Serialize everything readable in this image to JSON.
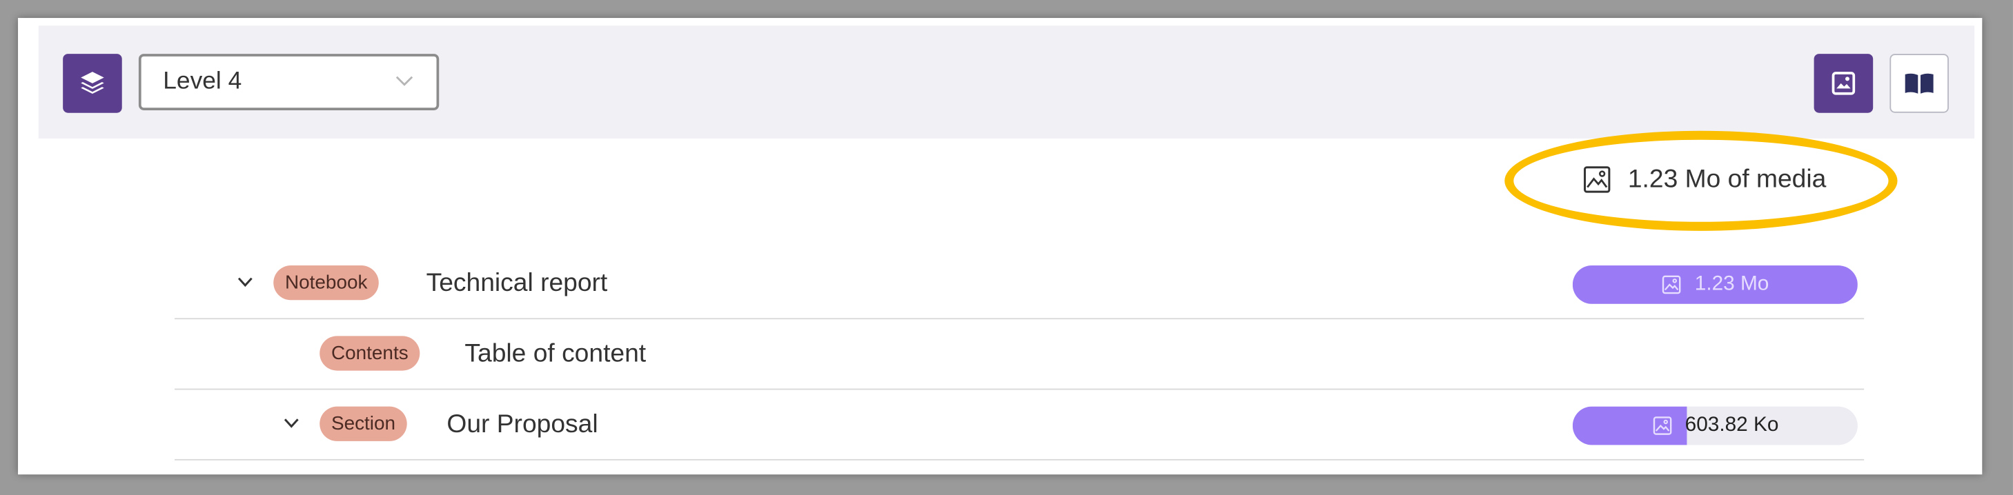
{
  "toolbar": {
    "level_select": {
      "selected": "Level 4"
    },
    "icons": {
      "layers": "layers-icon",
      "media": "image-icon",
      "book": "book-open-icon"
    }
  },
  "media_summary": {
    "label": "1.23 Mo of media",
    "icon": "image-icon",
    "highlight_color": "#fbbf00"
  },
  "tree": {
    "rows": [
      {
        "type_badge": "Notebook",
        "title": "Technical report",
        "expanded": true,
        "size_label": "1.23 Mo",
        "size_fraction": 1.0
      },
      {
        "type_badge": "Contents",
        "title": "Table of content"
      },
      {
        "type_badge": "Section",
        "title": "Our Proposal",
        "expanded": true,
        "size_label": "603.82 Ko",
        "size_fraction": 0.4
      }
    ]
  },
  "colors": {
    "accent": "#5b3e8d",
    "bar_fill": "#9b7bf5",
    "badge": "#e8a898"
  }
}
